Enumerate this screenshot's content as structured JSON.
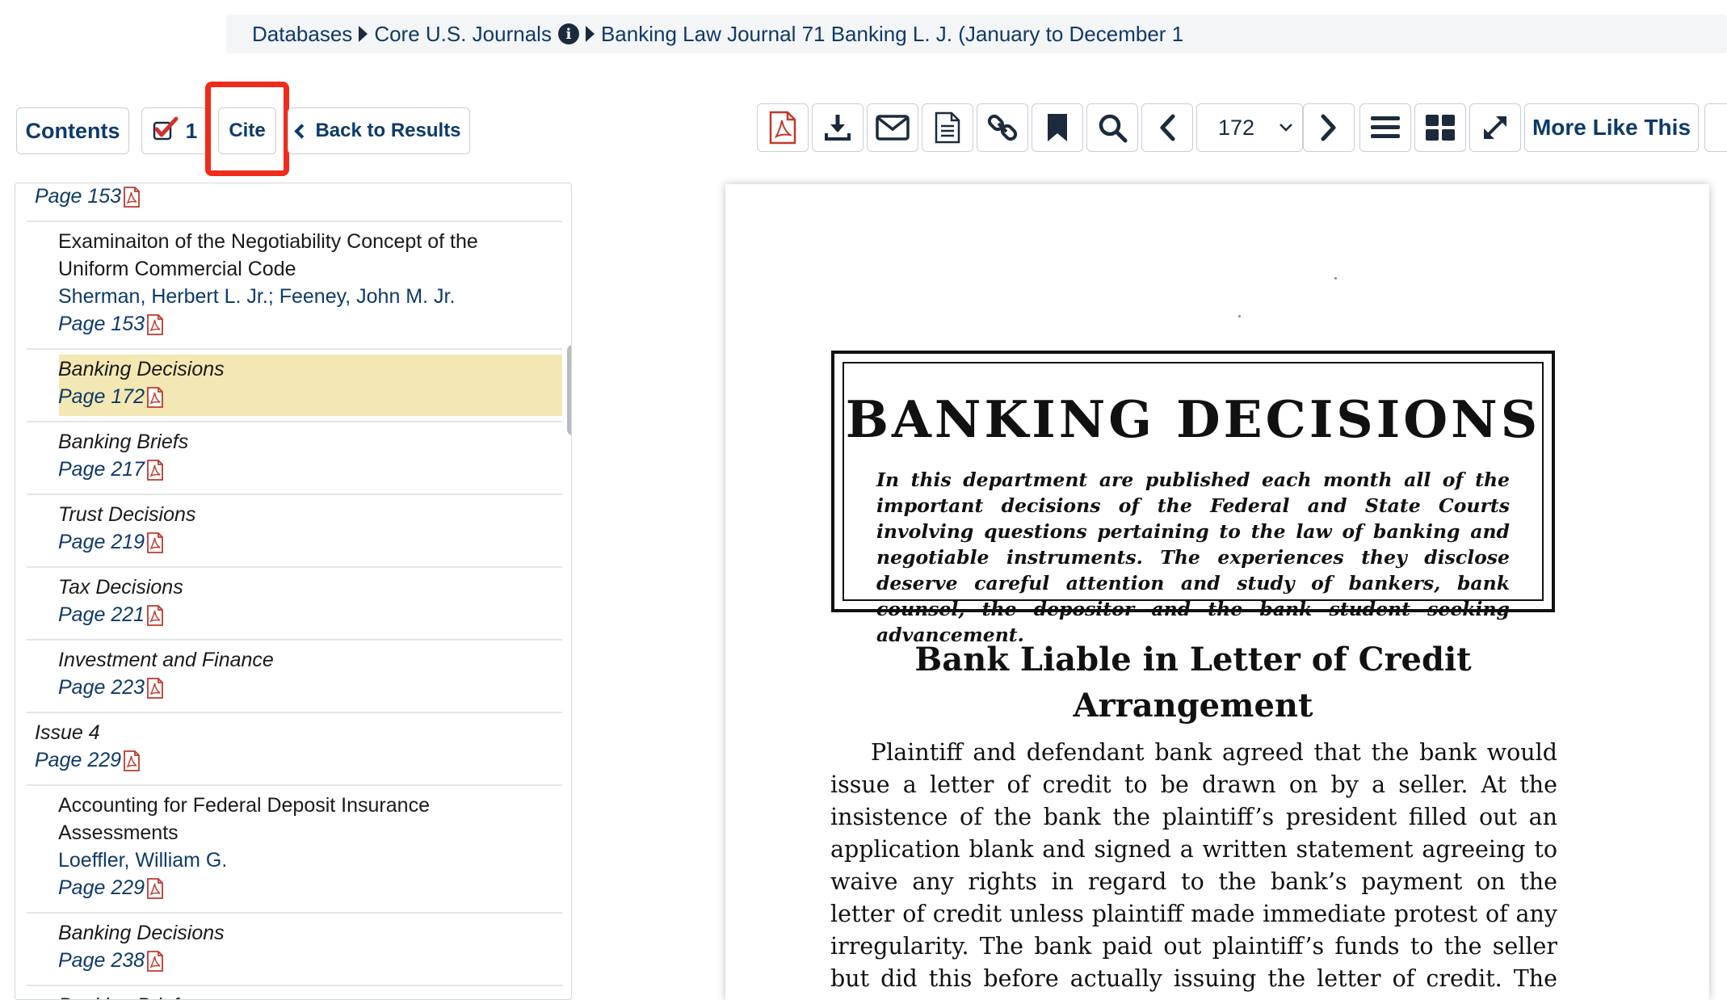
{
  "breadcrumb": {
    "items": [
      "Databases",
      "Core U.S. Journals",
      "Banking Law Journal 71 Banking L. J. (January to December 1"
    ]
  },
  "toolbar_left": {
    "contents_label": "Contents",
    "marked_count": "1",
    "cite_label": "Cite",
    "back_label": "Back to Results"
  },
  "toolbar_right": {
    "page_number": "172",
    "more_like_this": "More Like This",
    "icons": [
      "pdf-icon",
      "download-icon",
      "email-icon",
      "document-icon",
      "link-icon",
      "bookmark-icon",
      "search-icon",
      "prev-page-icon",
      "chevron-down-icon",
      "next-page-icon",
      "list-view-icon",
      "grid-view-icon",
      "expand-icon"
    ]
  },
  "toc": {
    "items": [
      {
        "lines": [
          {
            "text": "Page 153",
            "kind": "page"
          }
        ]
      },
      {
        "lines": [
          {
            "text": "Examinaiton of the Negotiability Concept of the",
            "kind": "title"
          },
          {
            "text": "Uniform Commercial Code",
            "kind": "title"
          },
          {
            "text": "Sherman, Herbert L. Jr.; Feeney, John M. Jr.",
            "kind": "author"
          },
          {
            "text": "Page 153",
            "kind": "page"
          }
        ]
      },
      {
        "highlight": true,
        "lines": [
          {
            "text": "Banking Decisions",
            "kind": "italic"
          },
          {
            "text": "Page 172",
            "kind": "page"
          }
        ]
      },
      {
        "lines": [
          {
            "text": "Banking Briefs",
            "kind": "italic"
          },
          {
            "text": "Page 217",
            "kind": "page"
          }
        ]
      },
      {
        "lines": [
          {
            "text": "Trust Decisions",
            "kind": "italic"
          },
          {
            "text": "Page 219",
            "kind": "page"
          }
        ]
      },
      {
        "lines": [
          {
            "text": "Tax Decisions",
            "kind": "italic"
          },
          {
            "text": "Page 221",
            "kind": "page"
          }
        ]
      },
      {
        "lines": [
          {
            "text": "Investment and Finance",
            "kind": "italic"
          },
          {
            "text": "Page 223",
            "kind": "page"
          }
        ]
      },
      {
        "lines": [
          {
            "text": "Issue 4",
            "kind": "italic"
          },
          {
            "text": "Page 229",
            "kind": "page"
          }
        ]
      },
      {
        "lines": [
          {
            "text": "Accounting for Federal Deposit Insurance",
            "kind": "title"
          },
          {
            "text": "Assessments",
            "kind": "title"
          },
          {
            "text": "Loeffler, William G.",
            "kind": "author"
          },
          {
            "text": "Page 229",
            "kind": "page"
          }
        ]
      },
      {
        "lines": [
          {
            "text": "Banking Decisions",
            "kind": "italic"
          },
          {
            "text": "Page 238",
            "kind": "page"
          }
        ]
      },
      {
        "lines": [
          {
            "text": "Banking Briefs",
            "kind": "italic"
          }
        ]
      }
    ]
  },
  "document": {
    "heading": "BANKING DECISIONS",
    "intro": "In this department are published each month all of the important decisions of the Federal and State Courts involving questions pertaining to the law of banking and negotiable instruments. The experiences they disclose deserve careful attention and study of bankers, bank counsel, the depositor and the bank student seeking advancement.",
    "subtitle_line1": "Bank Liable in Letter of Credit",
    "subtitle_line2": "Arrangement",
    "body": "Plaintiff and defendant bank agreed that the bank would issue a letter of credit to be drawn on by a seller. At the insistence of the bank the plaintiff’s president filled out an application blank and signed a written statement agreeing to waive any rights in regard to the bank’s payment on the letter of credit unless plaintiff made immediate protest of any irregularity. The bank paid out plaintiff’s funds to the seller but did this before actually issuing the letter of credit. The payment"
  },
  "colors": {
    "brand_blue": "#0d3a6b",
    "highlight": "#f3e8b3",
    "annotation_red": "#ef2b1c",
    "pdf_red": "#c0392b"
  }
}
